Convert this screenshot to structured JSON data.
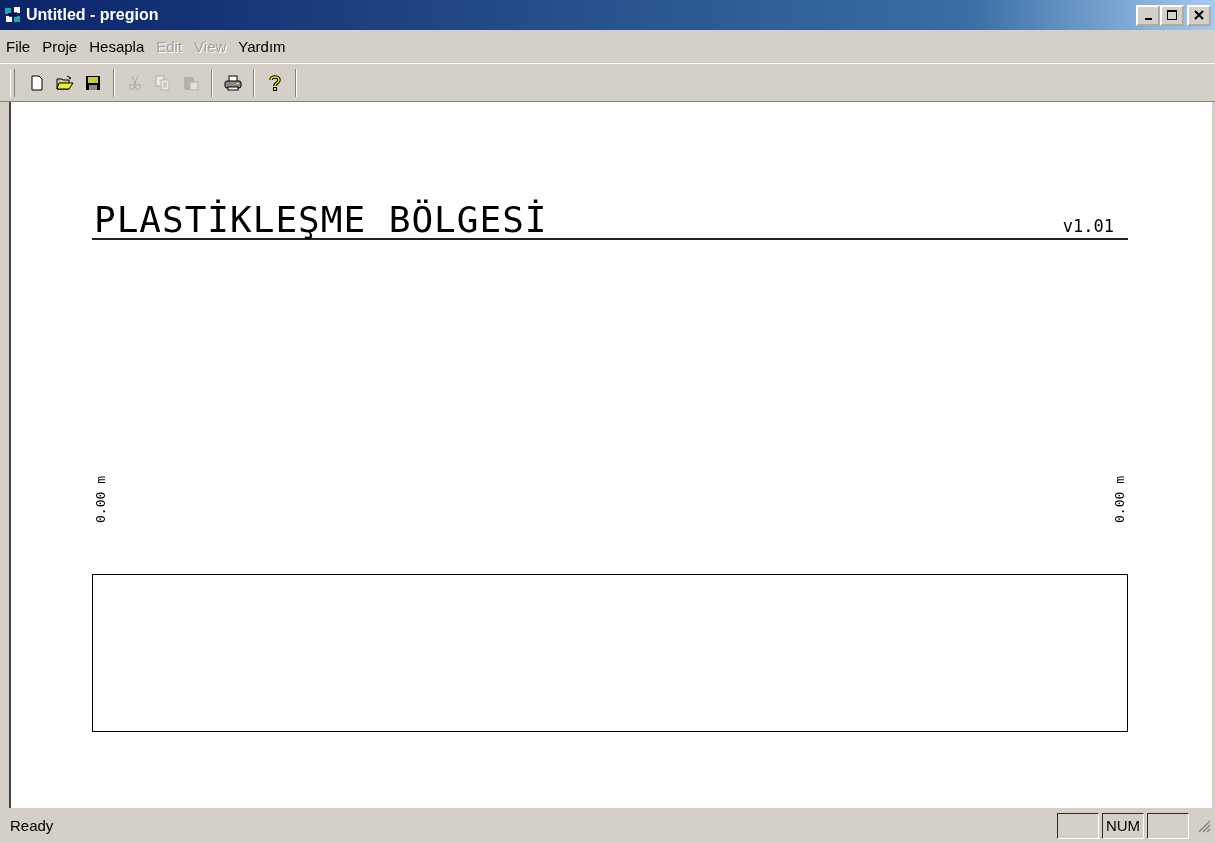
{
  "window": {
    "title": "Untitled - pregion"
  },
  "menu": [
    {
      "label": "File",
      "disabled": false
    },
    {
      "label": "Proje",
      "disabled": false
    },
    {
      "label": "Hesapla",
      "disabled": false
    },
    {
      "label": "Edit",
      "disabled": true
    },
    {
      "label": "View",
      "disabled": true
    },
    {
      "label": "Yardım",
      "disabled": false
    }
  ],
  "toolbar": [
    {
      "kind": "new",
      "disabled": false
    },
    {
      "kind": "open",
      "disabled": false
    },
    {
      "kind": "save",
      "disabled": false
    },
    {
      "kind": "separator"
    },
    {
      "kind": "cut",
      "disabled": true
    },
    {
      "kind": "copy",
      "disabled": true
    },
    {
      "kind": "paste",
      "disabled": true
    },
    {
      "kind": "separator"
    },
    {
      "kind": "print",
      "disabled": false
    },
    {
      "kind": "separator"
    },
    {
      "kind": "help",
      "disabled": false
    }
  ],
  "document": {
    "heading": "PLASTİKLEŞME BÖLGESİ",
    "version": "v1.01",
    "left_depth": "0.00 m",
    "right_depth": "0.00 m"
  },
  "status_bar": {
    "message": "Ready",
    "num_indicator": "NUM"
  }
}
